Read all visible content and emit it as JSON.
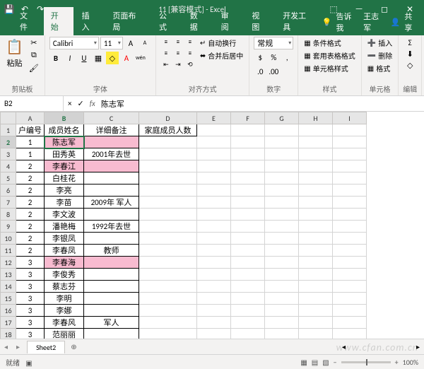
{
  "titlebar": {
    "title": "11 [兼容模式] - Excel"
  },
  "tabs": {
    "items": [
      "文件",
      "开始",
      "插入",
      "页面布局",
      "公式",
      "数据",
      "审阅",
      "视图",
      "开发工具"
    ],
    "tell": "告诉我",
    "user": "王志军",
    "share": "共享"
  },
  "ribbon": {
    "paste": "粘贴",
    "clipboard": "剪贴板",
    "font": "Calibri",
    "size": "11",
    "font_label": "字体",
    "align_label": "对齐方式",
    "wrap": "自动换行",
    "merge": "合并后居中",
    "number": "常规",
    "number_label": "数字",
    "cond": "条件格式",
    "table": "套用表格格式",
    "cell": "单元格样式",
    "style_label": "样式",
    "insert": "插入",
    "delete": "删除",
    "format": "格式",
    "cells_label": "单元格",
    "edit": "编辑"
  },
  "namebox": "B2",
  "formula": "陈志军",
  "columns": [
    "A",
    "B",
    "C",
    "D",
    "E",
    "F",
    "G",
    "H",
    "I"
  ],
  "headers": {
    "a": "户编号",
    "b": "成员姓名",
    "c": "详细备注",
    "d": "家庭成员人数"
  },
  "rows": [
    {
      "n": "2",
      "a": "1",
      "b": "陈志军",
      "c": "",
      "pink": true,
      "active": true
    },
    {
      "n": "3",
      "a": "1",
      "b": "田秀英",
      "c": "2001年去世"
    },
    {
      "n": "4",
      "a": "2",
      "b": "李春江",
      "c": "",
      "pink": true
    },
    {
      "n": "5",
      "a": "2",
      "b": "白桂花",
      "c": ""
    },
    {
      "n": "6",
      "a": "2",
      "b": "李亮",
      "c": ""
    },
    {
      "n": "7",
      "a": "2",
      "b": "李苗",
      "c": "2009年 军人"
    },
    {
      "n": "8",
      "a": "2",
      "b": "李文波",
      "c": ""
    },
    {
      "n": "9",
      "a": "2",
      "b": "潘艳梅",
      "c": "1992年去世"
    },
    {
      "n": "10",
      "a": "2",
      "b": "李银凤",
      "c": ""
    },
    {
      "n": "11",
      "a": "2",
      "b": "李春凤",
      "c": "教师"
    },
    {
      "n": "12",
      "a": "3",
      "b": "李春海",
      "c": "",
      "pink": true
    },
    {
      "n": "13",
      "a": "3",
      "b": "李俊秀",
      "c": ""
    },
    {
      "n": "14",
      "a": "3",
      "b": "蔡志芬",
      "c": ""
    },
    {
      "n": "15",
      "a": "3",
      "b": "李明",
      "c": ""
    },
    {
      "n": "16",
      "a": "3",
      "b": "李娜",
      "c": ""
    },
    {
      "n": "17",
      "a": "3",
      "b": "李春风",
      "c": "军人"
    },
    {
      "n": "18",
      "a": "3",
      "b": "范丽丽",
      "c": ""
    }
  ],
  "sheet": "Sheet2",
  "status": {
    "ready": "就绪",
    "zoom": "100%"
  },
  "watermark": "www.cfan.com.cn"
}
